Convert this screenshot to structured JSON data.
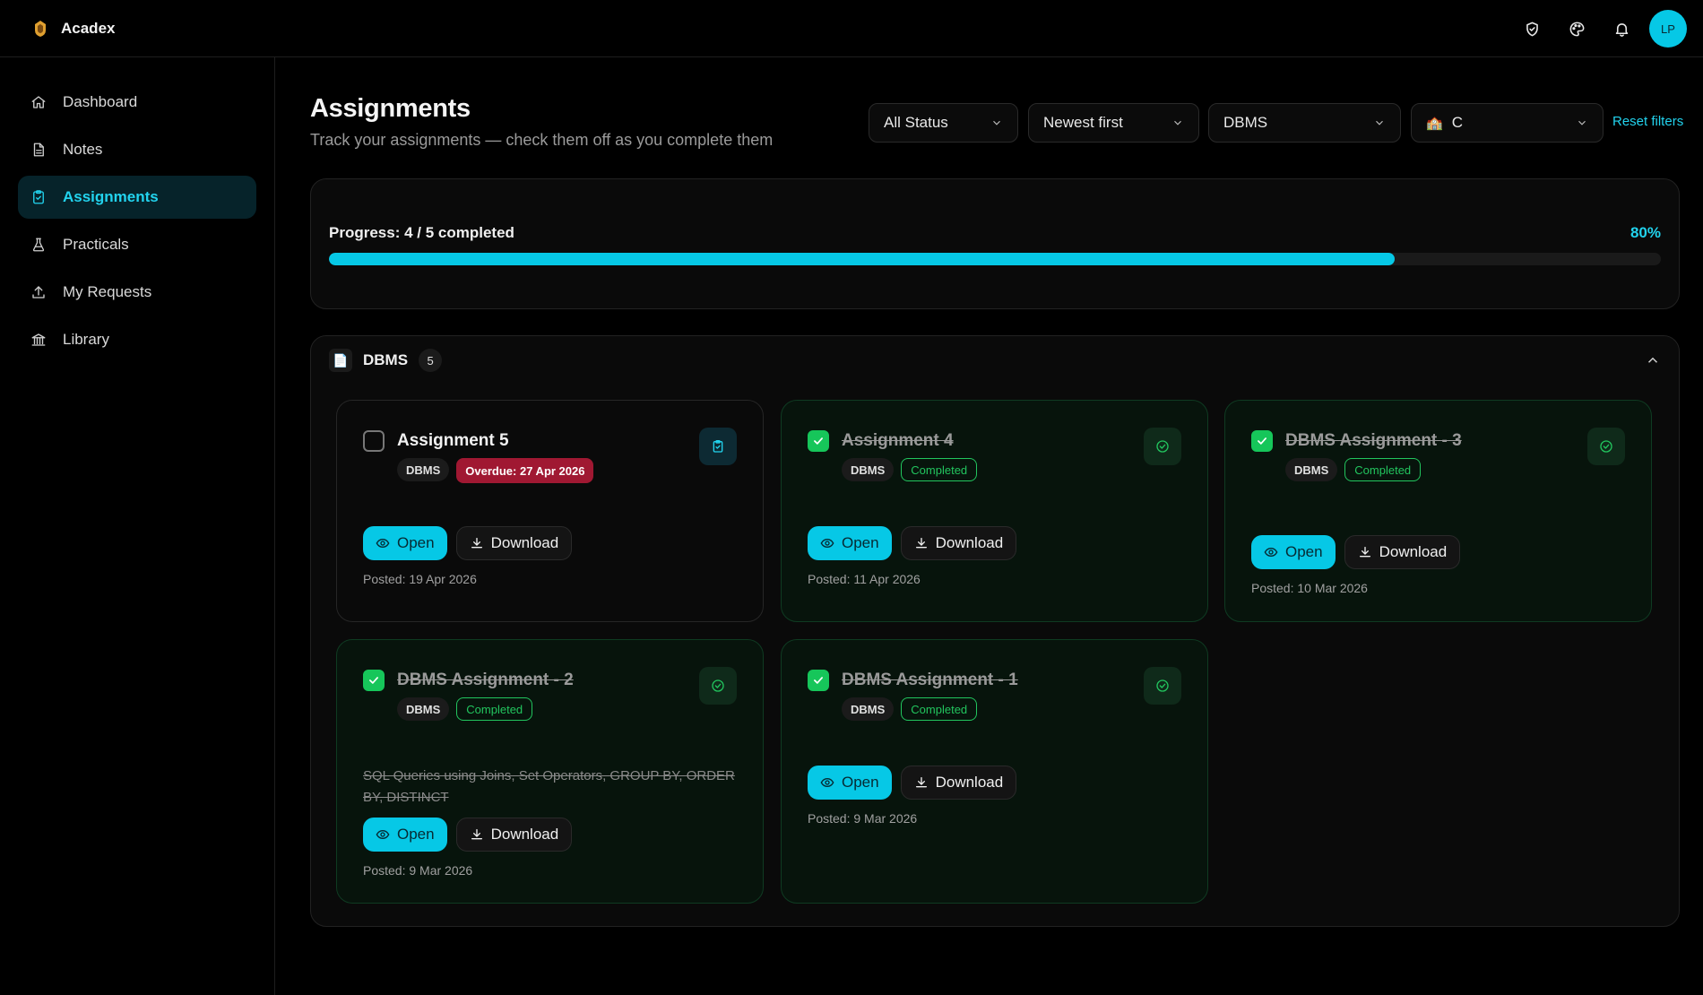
{
  "app": {
    "name": "Acadex",
    "avatar_initials": "LP"
  },
  "topbar": {
    "icons": [
      "shield-check-icon",
      "palette-icon",
      "bell-icon"
    ]
  },
  "sidebar": {
    "items": [
      {
        "label": "Dashboard",
        "icon": "home-icon",
        "active": false
      },
      {
        "label": "Notes",
        "icon": "file-text-icon",
        "active": false
      },
      {
        "label": "Assignments",
        "icon": "clipboard-check-icon",
        "active": true
      },
      {
        "label": "Practicals",
        "icon": "flask-icon",
        "active": false
      },
      {
        "label": "My Requests",
        "icon": "upload-icon",
        "active": false
      },
      {
        "label": "Library",
        "icon": "library-icon",
        "active": false
      }
    ]
  },
  "header": {
    "title": "Assignments",
    "subtitle": "Track your assignments — check them off as you complete them"
  },
  "filters": {
    "status": "All Status",
    "sort": "Newest first",
    "subject": "DBMS",
    "division_emoji": "🏫",
    "division": "C",
    "reset_label": "Reset filters"
  },
  "progress": {
    "label": "Progress: 4 / 5 completed",
    "percent_label": "80%",
    "fraction": 0.8
  },
  "group": {
    "name": "DBMS",
    "count": "5",
    "icon": "📄"
  },
  "buttons": {
    "open": "Open",
    "download": "Download"
  },
  "cards": [
    {
      "title": "Assignment 5",
      "subject": "DBMS",
      "status": "Overdue: 27 Apr 2026",
      "done": false,
      "description": "",
      "posted": "Posted: 19 Apr 2026"
    },
    {
      "title": "Assignment 4",
      "subject": "DBMS",
      "status": "Completed",
      "done": true,
      "description": "",
      "posted": "Posted: 11 Apr 2026"
    },
    {
      "title": "DBMS Assignment - 3",
      "subject": "DBMS",
      "status": "Completed",
      "done": true,
      "description": "",
      "posted": "Posted: 10 Mar 2026"
    },
    {
      "title": "DBMS Assignment - 2",
      "subject": "DBMS",
      "status": "Completed",
      "done": true,
      "description": "SQL Queries using Joins, Set Operators, GROUP BY, ORDER BY, DISTINCT",
      "posted": "Posted: 9 Mar 2026"
    },
    {
      "title": "DBMS Assignment - 1",
      "subject": "DBMS",
      "status": "Completed",
      "done": true,
      "description": "",
      "posted": "Posted: 9 Mar 2026"
    }
  ],
  "colors": {
    "accent": "#06c8e6",
    "success": "#22c55e",
    "danger": "#a01832"
  }
}
